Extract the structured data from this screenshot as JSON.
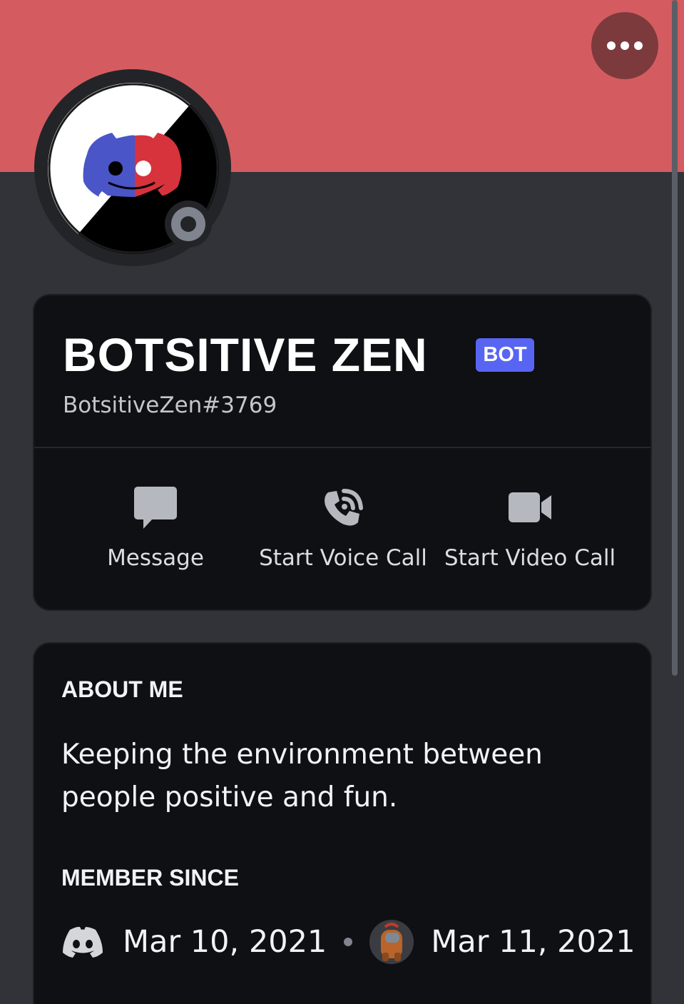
{
  "profile": {
    "display_name": "BOTSITIVE ZEN",
    "badge": "BOT",
    "username": "BotsitiveZen#3769",
    "status": "offline",
    "banner_color": "#d45c60"
  },
  "header": {
    "more_icon": "more-horizontal-icon"
  },
  "actions": [
    {
      "label": "Message",
      "icon": "message-bubble-icon"
    },
    {
      "label": "Start Voice Call",
      "icon": "phone-call-icon"
    },
    {
      "label": "Start Video Call",
      "icon": "video-camera-icon"
    }
  ],
  "about": {
    "title": "ABOUT ME",
    "text": "Keeping the environment between people positive and fun."
  },
  "member_since": {
    "title": "MEMBER SINCE",
    "discord_date": "Mar 10, 2021",
    "server_date": "Mar 11, 2021",
    "discord_icon": "discord-logo-icon",
    "server_icon": "server-avatar-icon"
  },
  "colors": {
    "accent": "#5865f2",
    "background": "#313338",
    "card": "#0f1013"
  }
}
